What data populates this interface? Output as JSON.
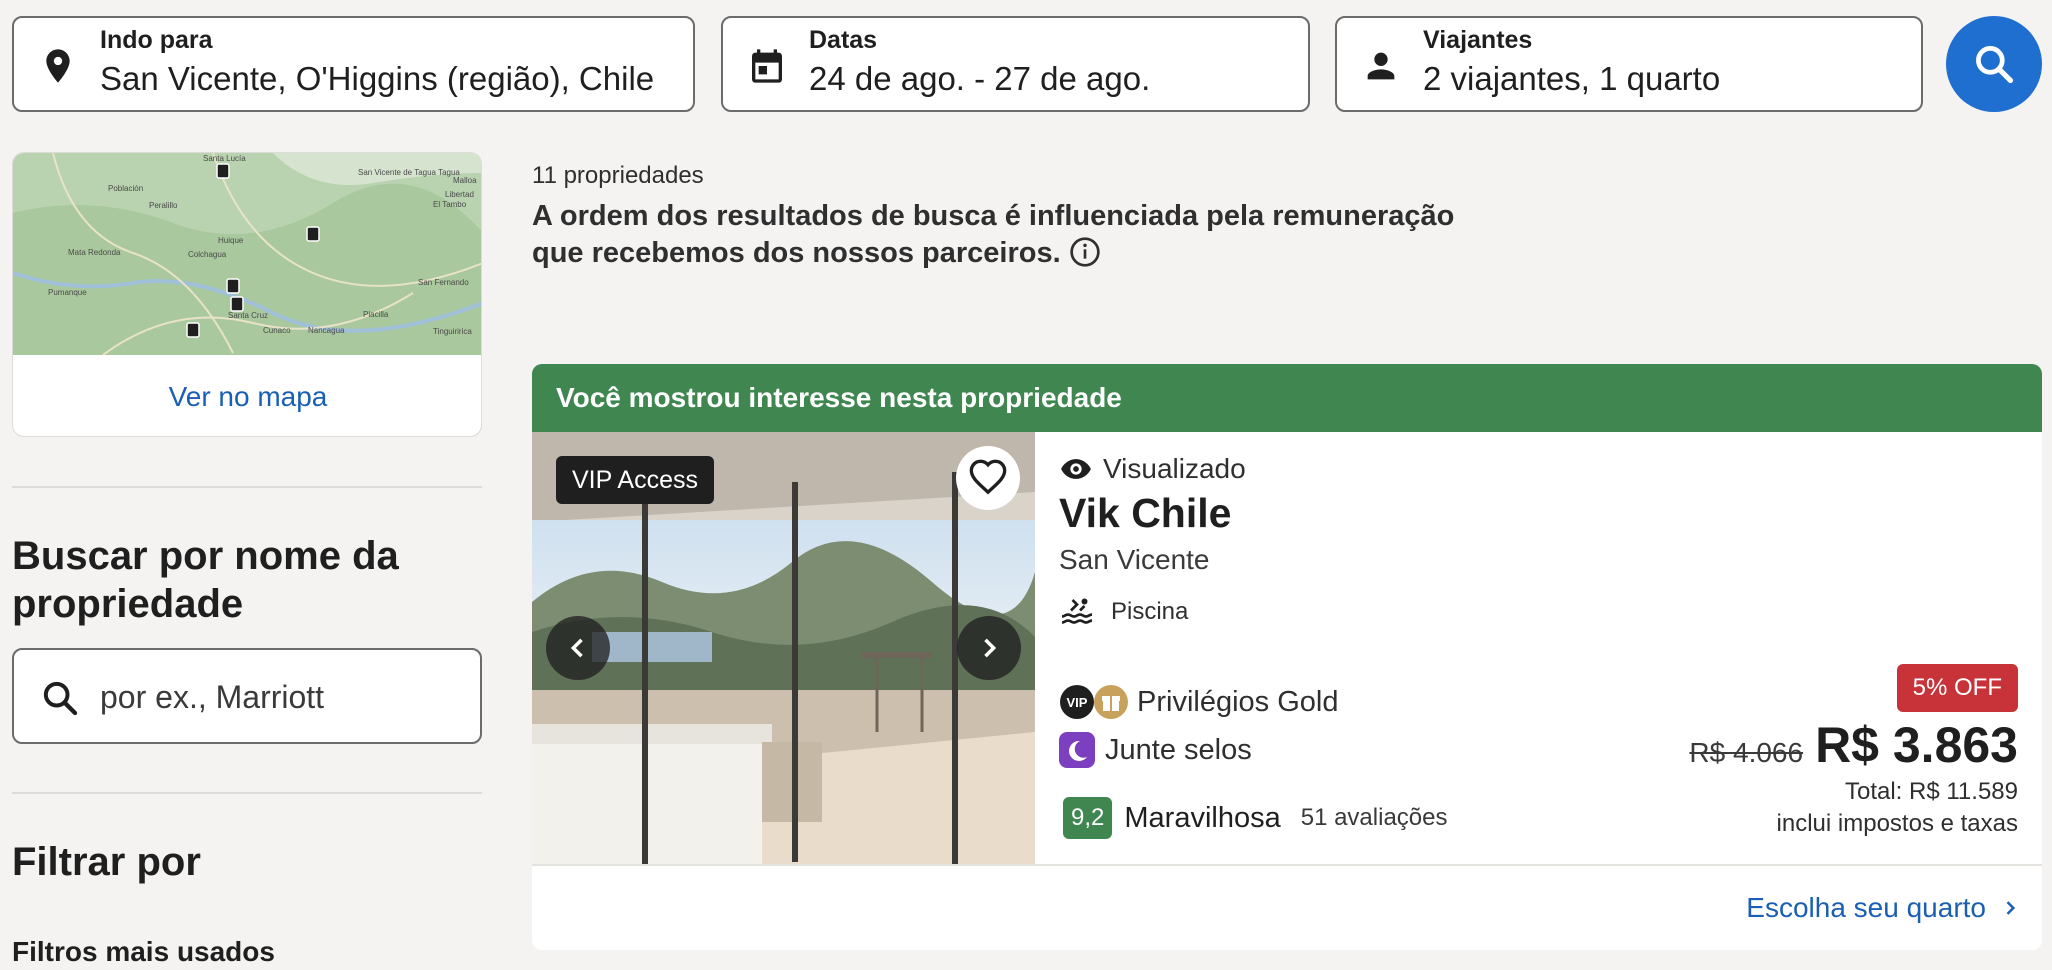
{
  "search": {
    "destination": {
      "label": "Indo para",
      "value": "San Vicente, O'Higgins (região), Chile",
      "icon": "location-pin-icon"
    },
    "dates": {
      "label": "Datas",
      "value": "24 de ago. - 27 de ago.",
      "icon": "calendar-icon"
    },
    "travelers": {
      "label": "Viajantes",
      "value": "2 viajantes, 1 quarto",
      "icon": "person-icon"
    },
    "button_icon": "search-icon"
  },
  "sidebar": {
    "map": {
      "link": "Ver no mapa",
      "places": [
        "Santa Lucía",
        "San Vicente de Tagua Tagua",
        "Malloa",
        "Libertad",
        "El Tambo",
        "Población",
        "Peralillo",
        "Huique",
        "Mata Redonda",
        "Colchagua",
        "Pumanque",
        "Santa Cruz",
        "San Fernando",
        "Cunaco",
        "Nancagua",
        "Placilla",
        "Tinguiririca"
      ]
    },
    "search_by_name": {
      "title": "Buscar por nome da propriedade",
      "placeholder": "por ex., Marriott"
    },
    "filter": {
      "title": "Filtrar por",
      "popular": "Filtros mais usados"
    }
  },
  "results": {
    "count": "11 propriedades",
    "disclaimer": "A ordem dos resultados de busca é influenciada pela remuneração que recebemos dos nossos parceiros."
  },
  "card": {
    "banner": "Você mostrou interesse nesta propriedade",
    "badge": "VIP Access",
    "viewed": "Visualizado",
    "name": "Vik Chile",
    "location": "San Vicente",
    "amenity": "Piscina",
    "program": "Privilégios Gold",
    "vip_mark": "VIP",
    "stamps": "Junte selos",
    "score": "9,2",
    "rating_word": "Maravilhosa",
    "reviews": "51 avaliações",
    "discount": "5% OFF",
    "old_price": "R$ 4.066",
    "price": "R$ 3.863",
    "total": "Total: R$ 11.589",
    "taxes": "inclui impostos e taxas",
    "cta": "Escolha seu quarto"
  },
  "colors": {
    "accent_blue": "#1e6fd0",
    "link_blue": "#1a5fb4",
    "banner_green": "#3f8650",
    "discount_red": "#c8333a",
    "background": "#f4f3f1"
  }
}
